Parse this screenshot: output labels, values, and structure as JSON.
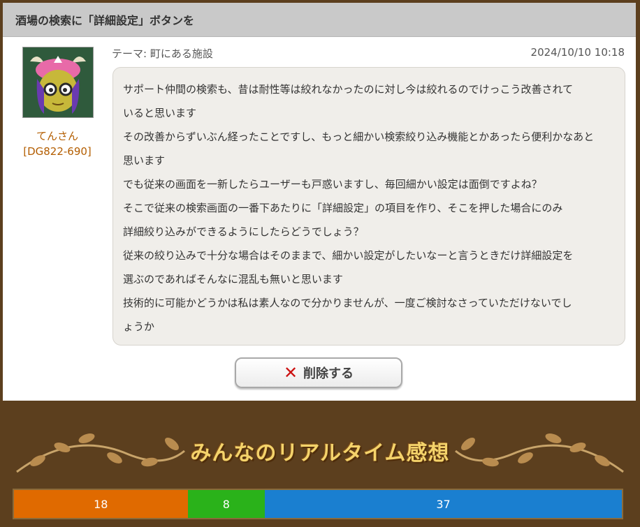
{
  "post": {
    "title": "酒場の検索に「詳細設定」ボタンを",
    "author_name": "てんさん",
    "author_id": "[DG822-690]",
    "theme": "テーマ: 町にある施設",
    "date": "2024/10/10 10:18",
    "body_lines": [
      "サポート仲間の検索も、昔は耐性等は絞れなかったのに対し今は絞れるのでけっこう改善されて",
      "いると思います",
      "その改善からずいぶん経ったことですし、もっと細かい検索絞り込み機能とかあったら便利かなあと",
      "思います",
      "でも従来の画面を一新したらユーザーも戸惑いますし、毎回細かい設定は面倒ですよね？",
      "そこで従来の検索画面の一番下あたりに「詳細設定」の項目を作り、そこを押した場合にのみ",
      "詳細絞り込みができるようにしたらどうでしょう？",
      "従来の絞り込みで十分な場合はそのままで、細かい設定がしたいなーと言うときだけ詳細設定を",
      "選ぶのであればそんなに混乱も無いと思います",
      "技術的に可能かどうかは私は素人なので分かりませんが、一度ご検討なさっていただけないでし",
      "ょうか"
    ]
  },
  "actions": {
    "delete_label": "削除する",
    "delete_icon": "close-icon"
  },
  "realtime": {
    "title": "みんなのリアルタイム感想",
    "segments": [
      {
        "value": 18,
        "color": "#e06a00"
      },
      {
        "value": 8,
        "color": "#2ab21a"
      },
      {
        "value": 37,
        "color": "#1a7fd0"
      }
    ]
  }
}
